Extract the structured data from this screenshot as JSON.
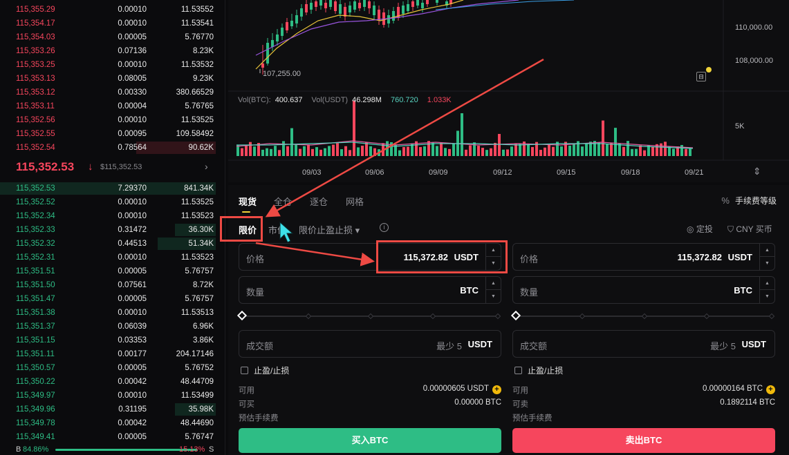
{
  "orderbook": {
    "asks": [
      {
        "price": "115,355.29",
        "amount": "0.00010",
        "total": "11.53552",
        "depth": 0
      },
      {
        "price": "115,354.17",
        "amount": "0.00010",
        "total": "11.53541",
        "depth": 0
      },
      {
        "price": "115,354.03",
        "amount": "0.00005",
        "total": "5.76770",
        "depth": 0
      },
      {
        "price": "115,353.26",
        "amount": "0.07136",
        "total": "8.23K",
        "depth": 0
      },
      {
        "price": "115,353.25",
        "amount": "0.00010",
        "total": "11.53532",
        "depth": 0
      },
      {
        "price": "115,353.13",
        "amount": "0.08005",
        "total": "9.23K",
        "depth": 0
      },
      {
        "price": "115,353.12",
        "amount": "0.00330",
        "total": "380.66529",
        "depth": 0
      },
      {
        "price": "115,353.11",
        "amount": "0.00004",
        "total": "5.76765",
        "depth": 0
      },
      {
        "price": "115,352.56",
        "amount": "0.00010",
        "total": "11.53525",
        "depth": 0
      },
      {
        "price": "115,352.55",
        "amount": "0.00095",
        "total": "109.58492",
        "depth": 0
      },
      {
        "price": "115,352.54",
        "amount": "0.78564",
        "total": "90.62K",
        "depth": 0.37
      }
    ],
    "mid_price": "115,352.53",
    "mid_arrow": "↓",
    "mid_usd": "$115,352.53",
    "bids": [
      {
        "price": "115,352.53",
        "amount": "7.29370",
        "total": "841.34K",
        "depth": 1.0
      },
      {
        "price": "115,352.52",
        "amount": "0.00010",
        "total": "11.53525",
        "depth": 0
      },
      {
        "price": "115,352.34",
        "amount": "0.00010",
        "total": "11.53523",
        "depth": 0
      },
      {
        "price": "115,352.33",
        "amount": "0.31472",
        "total": "36.30K",
        "depth": 0.19
      },
      {
        "price": "115,352.32",
        "amount": "0.44513",
        "total": "51.34K",
        "depth": 0.27
      },
      {
        "price": "115,352.31",
        "amount": "0.00010",
        "total": "11.53523",
        "depth": 0
      },
      {
        "price": "115,351.51",
        "amount": "0.00005",
        "total": "5.76757",
        "depth": 0
      },
      {
        "price": "115,351.50",
        "amount": "0.07561",
        "total": "8.72K",
        "depth": 0
      },
      {
        "price": "115,351.47",
        "amount": "0.00005",
        "total": "5.76757",
        "depth": 0
      },
      {
        "price": "115,351.38",
        "amount": "0.00010",
        "total": "11.53513",
        "depth": 0
      },
      {
        "price": "115,351.37",
        "amount": "0.06039",
        "total": "6.96K",
        "depth": 0
      },
      {
        "price": "115,351.15",
        "amount": "0.03353",
        "total": "3.86K",
        "depth": 0
      },
      {
        "price": "115,351.11",
        "amount": "0.00177",
        "total": "204.17146",
        "depth": 0
      },
      {
        "price": "115,350.57",
        "amount": "0.00005",
        "total": "5.76752",
        "depth": 0
      },
      {
        "price": "115,350.22",
        "amount": "0.00042",
        "total": "48.44709",
        "depth": 0
      },
      {
        "price": "115,349.97",
        "amount": "0.00010",
        "total": "11.53499",
        "depth": 0
      },
      {
        "price": "115,349.96",
        "amount": "0.31195",
        "total": "35.98K",
        "depth": 0.19
      },
      {
        "price": "115,349.78",
        "amount": "0.00042",
        "total": "48.44690",
        "depth": 0
      },
      {
        "price": "115,349.41",
        "amount": "0.00005",
        "total": "5.76747",
        "depth": 0
      }
    ],
    "ratio": {
      "b_label": "B",
      "b_pct": "84.86%",
      "s_pct": "15.13%",
      "s_label": "S",
      "b_fraction": 0.8486
    }
  },
  "chart": {
    "price_labels": [
      "110,000.00",
      "108,000.00"
    ],
    "low_marker": "107,255.00",
    "vol_axis_label": "5K",
    "date_labels": [
      "09/03",
      "09/06",
      "09/09",
      "09/12",
      "09/15",
      "09/18",
      "09/21"
    ],
    "vol_legend": {
      "btc_label": "Vol(BTC):",
      "btc_value": "400.637",
      "usdt_label": "Vol(USDT)",
      "usdt_value": "46.298M",
      "ma1": "760.720",
      "ma2": "1.033K"
    },
    "colors": {
      "up": "#2ebd85",
      "down": "#f6465d",
      "ma_yellow": "#e8c33a",
      "ma_purple": "#9a55e0"
    }
  },
  "trade": {
    "tabs": [
      "现货",
      "全仓",
      "逐仓",
      "网格"
    ],
    "fee_icon": "%",
    "fee_level": "手续费等级",
    "order_types": {
      "limit": "限价",
      "market": "市价",
      "stop_limit": "限价止盈止损 ▾"
    },
    "info_icon": "i",
    "dingtou": "定投",
    "cny_buy": "CNY 买币",
    "buy": {
      "price_label": "价格",
      "price_value": "115,372.82",
      "price_unit": "USDT",
      "qty_label": "数量",
      "qty_unit": "BTC",
      "total_label": "成交额",
      "total_min": "最少 5",
      "total_unit": "USDT",
      "tpsl_label": "止盈/止损",
      "avail_label": "可用",
      "avail_value": "0.00000605 USDT",
      "can_label": "可买",
      "can_value": "0.00000 BTC",
      "fee_label": "预估手续费",
      "button": "买入BTC"
    },
    "sell": {
      "price_label": "价格",
      "price_value": "115,372.82",
      "price_unit": "USDT",
      "qty_label": "数量",
      "qty_unit": "BTC",
      "total_label": "成交额",
      "total_min": "最少 5",
      "total_unit": "USDT",
      "tpsl_label": "止盈/止损",
      "avail_label": "可用",
      "avail_value": "0.00000164 BTC",
      "can_label": "可卖",
      "can_value": "0.1892114 BTC",
      "fee_label": "预估手续费",
      "button": "卖出BTC"
    }
  },
  "annotation_color": "#ee4a44"
}
